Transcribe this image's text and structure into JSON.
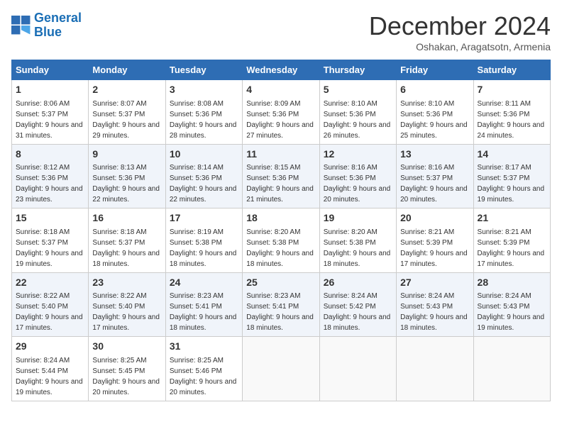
{
  "header": {
    "logo_line1": "General",
    "logo_line2": "Blue",
    "month_title": "December 2024",
    "subtitle": "Oshakan, Aragatsotn, Armenia"
  },
  "weekdays": [
    "Sunday",
    "Monday",
    "Tuesday",
    "Wednesday",
    "Thursday",
    "Friday",
    "Saturday"
  ],
  "weeks": [
    [
      {
        "day": "1",
        "sunrise": "8:06 AM",
        "sunset": "5:37 PM",
        "daylight": "9 hours and 31 minutes."
      },
      {
        "day": "2",
        "sunrise": "8:07 AM",
        "sunset": "5:37 PM",
        "daylight": "9 hours and 29 minutes."
      },
      {
        "day": "3",
        "sunrise": "8:08 AM",
        "sunset": "5:36 PM",
        "daylight": "9 hours and 28 minutes."
      },
      {
        "day": "4",
        "sunrise": "8:09 AM",
        "sunset": "5:36 PM",
        "daylight": "9 hours and 27 minutes."
      },
      {
        "day": "5",
        "sunrise": "8:10 AM",
        "sunset": "5:36 PM",
        "daylight": "9 hours and 26 minutes."
      },
      {
        "day": "6",
        "sunrise": "8:10 AM",
        "sunset": "5:36 PM",
        "daylight": "9 hours and 25 minutes."
      },
      {
        "day": "7",
        "sunrise": "8:11 AM",
        "sunset": "5:36 PM",
        "daylight": "9 hours and 24 minutes."
      }
    ],
    [
      {
        "day": "8",
        "sunrise": "8:12 AM",
        "sunset": "5:36 PM",
        "daylight": "9 hours and 23 minutes."
      },
      {
        "day": "9",
        "sunrise": "8:13 AM",
        "sunset": "5:36 PM",
        "daylight": "9 hours and 22 minutes."
      },
      {
        "day": "10",
        "sunrise": "8:14 AM",
        "sunset": "5:36 PM",
        "daylight": "9 hours and 22 minutes."
      },
      {
        "day": "11",
        "sunrise": "8:15 AM",
        "sunset": "5:36 PM",
        "daylight": "9 hours and 21 minutes."
      },
      {
        "day": "12",
        "sunrise": "8:16 AM",
        "sunset": "5:36 PM",
        "daylight": "9 hours and 20 minutes."
      },
      {
        "day": "13",
        "sunrise": "8:16 AM",
        "sunset": "5:37 PM",
        "daylight": "9 hours and 20 minutes."
      },
      {
        "day": "14",
        "sunrise": "8:17 AM",
        "sunset": "5:37 PM",
        "daylight": "9 hours and 19 minutes."
      }
    ],
    [
      {
        "day": "15",
        "sunrise": "8:18 AM",
        "sunset": "5:37 PM",
        "daylight": "9 hours and 19 minutes."
      },
      {
        "day": "16",
        "sunrise": "8:18 AM",
        "sunset": "5:37 PM",
        "daylight": "9 hours and 18 minutes."
      },
      {
        "day": "17",
        "sunrise": "8:19 AM",
        "sunset": "5:38 PM",
        "daylight": "9 hours and 18 minutes."
      },
      {
        "day": "18",
        "sunrise": "8:20 AM",
        "sunset": "5:38 PM",
        "daylight": "9 hours and 18 minutes."
      },
      {
        "day": "19",
        "sunrise": "8:20 AM",
        "sunset": "5:38 PM",
        "daylight": "9 hours and 18 minutes."
      },
      {
        "day": "20",
        "sunrise": "8:21 AM",
        "sunset": "5:39 PM",
        "daylight": "9 hours and 17 minutes."
      },
      {
        "day": "21",
        "sunrise": "8:21 AM",
        "sunset": "5:39 PM",
        "daylight": "9 hours and 17 minutes."
      }
    ],
    [
      {
        "day": "22",
        "sunrise": "8:22 AM",
        "sunset": "5:40 PM",
        "daylight": "9 hours and 17 minutes."
      },
      {
        "day": "23",
        "sunrise": "8:22 AM",
        "sunset": "5:40 PM",
        "daylight": "9 hours and 17 minutes."
      },
      {
        "day": "24",
        "sunrise": "8:23 AM",
        "sunset": "5:41 PM",
        "daylight": "9 hours and 18 minutes."
      },
      {
        "day": "25",
        "sunrise": "8:23 AM",
        "sunset": "5:41 PM",
        "daylight": "9 hours and 18 minutes."
      },
      {
        "day": "26",
        "sunrise": "8:24 AM",
        "sunset": "5:42 PM",
        "daylight": "9 hours and 18 minutes."
      },
      {
        "day": "27",
        "sunrise": "8:24 AM",
        "sunset": "5:43 PM",
        "daylight": "9 hours and 18 minutes."
      },
      {
        "day": "28",
        "sunrise": "8:24 AM",
        "sunset": "5:43 PM",
        "daylight": "9 hours and 19 minutes."
      }
    ],
    [
      {
        "day": "29",
        "sunrise": "8:24 AM",
        "sunset": "5:44 PM",
        "daylight": "9 hours and 19 minutes."
      },
      {
        "day": "30",
        "sunrise": "8:25 AM",
        "sunset": "5:45 PM",
        "daylight": "9 hours and 20 minutes."
      },
      {
        "day": "31",
        "sunrise": "8:25 AM",
        "sunset": "5:46 PM",
        "daylight": "9 hours and 20 minutes."
      },
      null,
      null,
      null,
      null
    ]
  ]
}
